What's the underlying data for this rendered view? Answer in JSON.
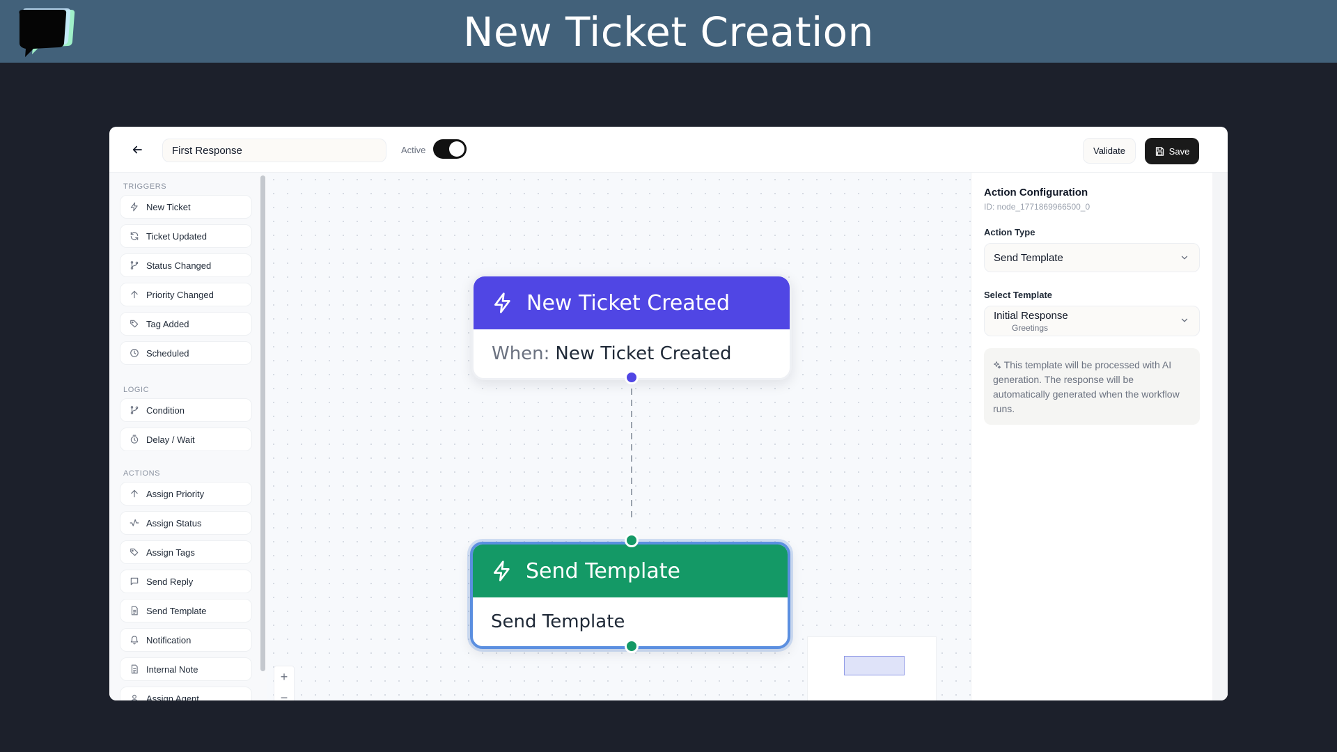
{
  "banner": {
    "title": "New Ticket Creation",
    "logo_icon": "chat-bubble-logo"
  },
  "toolbar": {
    "workflow_name": "First Response",
    "active_label": "Active",
    "active": true,
    "validate_label": "Validate",
    "save_label": "Save"
  },
  "sidebar": {
    "sections": [
      {
        "title": "TRIGGERS",
        "items": [
          {
            "label": "New Ticket",
            "icon": "bolt-icon"
          },
          {
            "label": "Ticket Updated",
            "icon": "refresh-icon"
          },
          {
            "label": "Status Changed",
            "icon": "branch-icon"
          },
          {
            "label": "Priority Changed",
            "icon": "arrow-up-icon"
          },
          {
            "label": "Tag Added",
            "icon": "tags-icon"
          },
          {
            "label": "Scheduled",
            "icon": "clock-icon"
          }
        ]
      },
      {
        "title": "LOGIC",
        "items": [
          {
            "label": "Condition",
            "icon": "branch-icon"
          },
          {
            "label": "Delay / Wait",
            "icon": "timer-icon"
          }
        ]
      },
      {
        "title": "ACTIONS",
        "items": [
          {
            "label": "Assign Priority",
            "icon": "arrow-up-icon"
          },
          {
            "label": "Assign Status",
            "icon": "activity-icon"
          },
          {
            "label": "Assign Tags",
            "icon": "tags-icon"
          },
          {
            "label": "Send Reply",
            "icon": "message-icon"
          },
          {
            "label": "Send Template",
            "icon": "document-icon"
          },
          {
            "label": "Notification",
            "icon": "bell-icon"
          },
          {
            "label": "Internal Note",
            "icon": "document-icon"
          },
          {
            "label": "Assign Agent",
            "icon": "user-icon"
          }
        ]
      }
    ]
  },
  "canvas": {
    "trigger_node": {
      "title": "New Ticket Created",
      "when_label": "When:",
      "when_value": "New Ticket Created",
      "color": "#5046e4"
    },
    "action_node": {
      "title": "Send Template",
      "body": "Send Template",
      "color": "#149966"
    },
    "zoom_in": "+",
    "zoom_out": "−"
  },
  "panel": {
    "title": "Action Configuration",
    "node_id": "ID: node_1771869966500_0",
    "action_type_label": "Action Type",
    "action_type_value": "Send Template",
    "template_label": "Select Template",
    "template_value": "Initial Response",
    "template_category": "Greetings",
    "info_text": "This template will be processed with AI generation. The response will be automatically generated when the workflow runs."
  }
}
